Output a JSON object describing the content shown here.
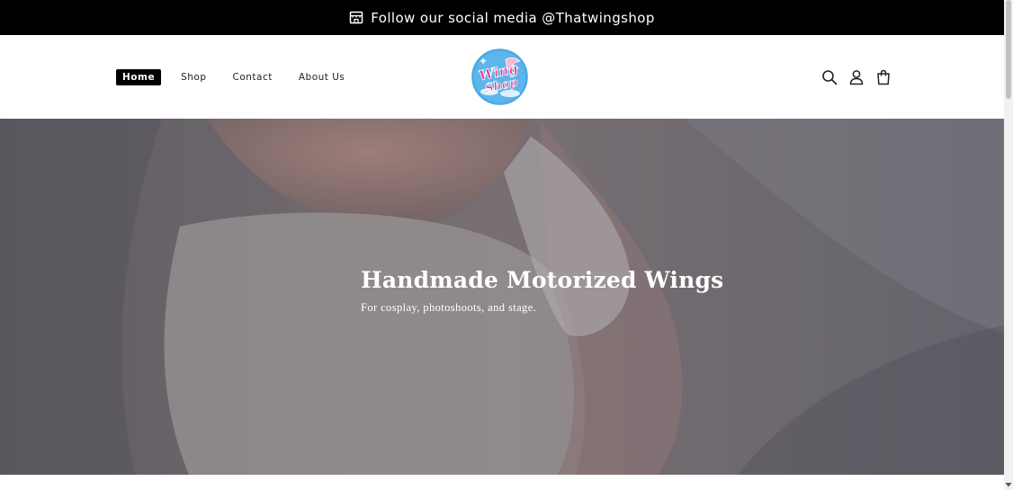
{
  "announcement": {
    "icon": "storefront-icon",
    "text": "Follow our social media @Thatwingshop"
  },
  "header": {
    "nav": [
      {
        "label": "Home",
        "active": true
      },
      {
        "label": "Shop",
        "active": false
      },
      {
        "label": "Contact",
        "active": false
      },
      {
        "label": "About Us",
        "active": false
      }
    ],
    "logo": {
      "text": "Wing Shop",
      "icon": "wing-shop-logo"
    },
    "icons": [
      "search-icon",
      "account-icon",
      "cart-icon"
    ]
  },
  "hero": {
    "title": "Handmade Motorized Wings",
    "subtitle": "For cosplay, photoshoots, and stage."
  },
  "colors": {
    "announcement_bg": "#000000",
    "logo_circle": "#4aa8e3",
    "logo_text": "#e8358a"
  }
}
